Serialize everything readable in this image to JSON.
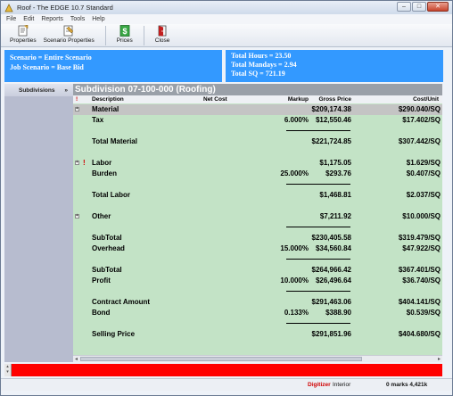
{
  "window": {
    "title": "Roof - The EDGE 10.7 Standard"
  },
  "menu": [
    "File",
    "Edit",
    "Reports",
    "Tools",
    "Help"
  ],
  "toolbar": {
    "properties": "Properties",
    "scenario_properties": "Scenario Properties",
    "prices": "Prices",
    "close": "Close"
  },
  "summary": {
    "scenario": "Scenario = Entire Scenario",
    "job_scenario": "Job Scenario = Base Bid",
    "total_hours": "Total Hours = 23.50",
    "total_mandays": "Total Mandays = 2.94",
    "total_sq": "Total SQ = 721.19"
  },
  "sidebar": {
    "title": "Subdivisions"
  },
  "main": {
    "title": "Subdivision 07-100-000 (Roofing)",
    "columns": {
      "flag": "!",
      "description": "Description",
      "net_cost": "Net Cost",
      "markup": "Markup",
      "gross_price": "Gross Price",
      "cost_unit": "Cost/Unit"
    },
    "rows": [
      {
        "label": "Material",
        "markup": "",
        "gross": "$209,174.38",
        "cost": "$290.040/SQ",
        "expander": "+",
        "flag": ""
      },
      {
        "label": "Tax",
        "markup": "6.000%",
        "gross": "$12,550.46",
        "cost": "$17.402/SQ",
        "expander": "",
        "flag": ""
      },
      {
        "label": "Total Material",
        "markup": "",
        "gross": "$221,724.85",
        "cost": "$307.442/SQ",
        "expander": "",
        "flag": ""
      },
      {
        "label": "Labor",
        "markup": "",
        "gross": "$1,175.05",
        "cost": "$1.629/SQ",
        "expander": "+",
        "flag": "!"
      },
      {
        "label": "Burden",
        "markup": "25.000%",
        "gross": "$293.76",
        "cost": "$0.407/SQ",
        "expander": "",
        "flag": ""
      },
      {
        "label": "Total Labor",
        "markup": "",
        "gross": "$1,468.81",
        "cost": "$2.037/SQ",
        "expander": "",
        "flag": ""
      },
      {
        "label": "Other",
        "markup": "",
        "gross": "$7,211.92",
        "cost": "$10.000/SQ",
        "expander": "+",
        "flag": ""
      },
      {
        "label": "SubTotal",
        "markup": "",
        "gross": "$230,405.58",
        "cost": "$319.479/SQ",
        "expander": "",
        "flag": ""
      },
      {
        "label": "Overhead",
        "markup": "15.000%",
        "gross": "$34,560.84",
        "cost": "$47.922/SQ",
        "expander": "",
        "flag": ""
      },
      {
        "label": "SubTotal",
        "markup": "",
        "gross": "$264,966.42",
        "cost": "$367.401/SQ",
        "expander": "",
        "flag": ""
      },
      {
        "label": "Profit",
        "markup": "10.000%",
        "gross": "$26,496.64",
        "cost": "$36.740/SQ",
        "expander": "",
        "flag": ""
      },
      {
        "label": "Contract Amount",
        "markup": "",
        "gross": "$291,463.06",
        "cost": "$404.141/SQ",
        "expander": "",
        "flag": ""
      },
      {
        "label": "Bond",
        "markup": "0.133%",
        "gross": "$388.90",
        "cost": "$0.539/SQ",
        "expander": "",
        "flag": ""
      },
      {
        "label": "Selling Price",
        "markup": "",
        "gross": "$291,851.96",
        "cost": "$404.680/SQ",
        "expander": "",
        "flag": ""
      }
    ]
  },
  "status": {
    "digitizer": "Digitizer",
    "mode": "Interior",
    "marks": "0 marks 4,421k"
  }
}
